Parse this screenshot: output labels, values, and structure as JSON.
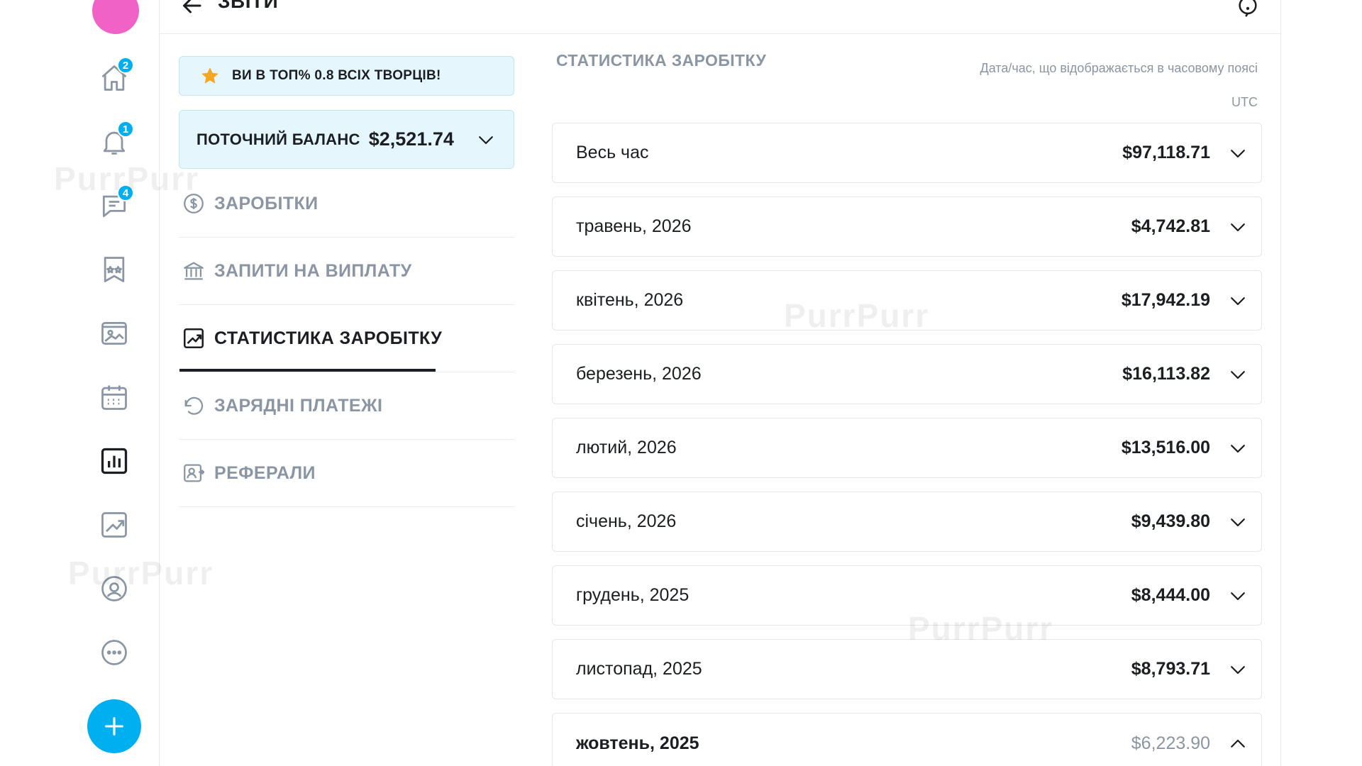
{
  "header": {
    "title": "ЗВІТИ",
    "back_icon": "arrow-left-icon",
    "help_icon": "help-icon"
  },
  "rail": {
    "avatar_color": "#f062c6",
    "items": [
      {
        "icon": "home-icon",
        "badge": "2"
      },
      {
        "icon": "bell-icon",
        "badge": "1"
      },
      {
        "icon": "messages-icon",
        "badge": "4"
      },
      {
        "icon": "collections-icon",
        "badge": null
      },
      {
        "icon": "vault-icon",
        "badge": null
      },
      {
        "icon": "calendar-icon",
        "badge": null
      },
      {
        "icon": "statistics-icon",
        "badge": null
      },
      {
        "icon": "analytics-icon",
        "badge": null
      },
      {
        "icon": "profile-icon",
        "badge": null
      },
      {
        "icon": "more-icon",
        "badge": null
      }
    ],
    "fab_icon": "plus-icon",
    "accent": "#00aff0"
  },
  "sidebar": {
    "top_banner": "ВИ В ТОП% 0.8 ВСІХ ТВОРЦІВ!",
    "balance_label": "ПОТОЧНИЙ БАЛАНС",
    "balance_value": "$2,521.74",
    "menu": [
      {
        "label": "ЗАРОБІТКИ",
        "icon": "dollar-circle-icon",
        "active": false
      },
      {
        "label": "ЗАПИТИ НА ВИПЛАТУ",
        "icon": "bank-icon",
        "active": false
      },
      {
        "label": "СТАТИСТИКА ЗАРОБІТКУ",
        "icon": "chart-trend-icon",
        "active": true
      },
      {
        "label": "ЗАРЯДНІ ПЛАТЕЖІ",
        "icon": "undo-icon",
        "active": false
      },
      {
        "label": "РЕФЕРАЛИ",
        "icon": "referral-icon",
        "active": false
      }
    ]
  },
  "main": {
    "section_title": "СТАТИСТИКА ЗАРОБІТКУ",
    "tz_note": "Дата/час, що відображається в часовому поясі",
    "tz_value": "UTC",
    "rows": [
      {
        "label": "Весь час",
        "value": "$97,118.71",
        "expanded": false
      },
      {
        "label": "травень, 2026",
        "value": "$4,742.81",
        "expanded": false
      },
      {
        "label": "квітень, 2026",
        "value": "$17,942.19",
        "expanded": false
      },
      {
        "label": "березень, 2026",
        "value": "$16,113.82",
        "expanded": false
      },
      {
        "label": "лютий, 2026",
        "value": "$13,516.00",
        "expanded": false
      },
      {
        "label": "січень, 2026",
        "value": "$9,439.80",
        "expanded": false
      },
      {
        "label": "грудень, 2025",
        "value": "$8,444.00",
        "expanded": false
      },
      {
        "label": "листопад, 2025",
        "value": "$8,793.71",
        "expanded": false
      },
      {
        "label": "жовтень, 2025",
        "value": "$6,223.90",
        "expanded": true
      }
    ]
  },
  "watermark": "PurrPurr"
}
